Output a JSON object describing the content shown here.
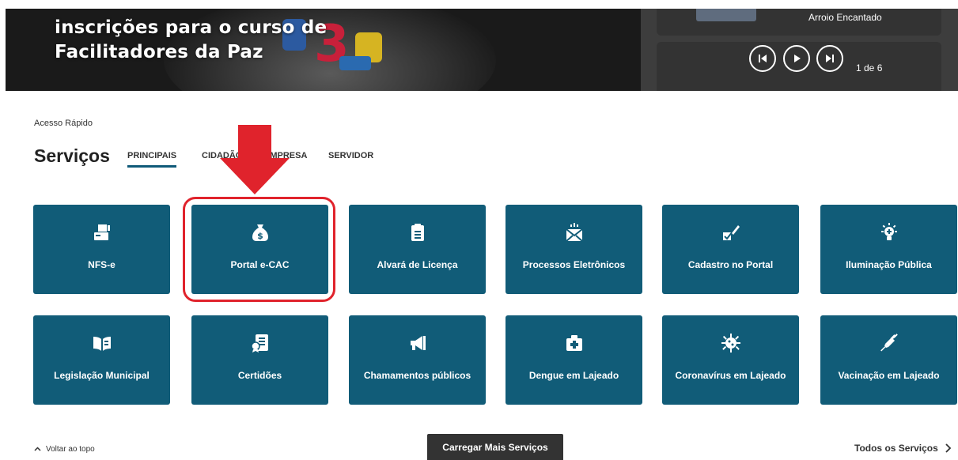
{
  "hero": {
    "title_line1": "inscrições para o curso de",
    "title_line2": "Facilitadores da Paz",
    "side_caption": "Arroio Encantado",
    "counter": "1 de 6"
  },
  "services": {
    "quick_access": "Acesso Rápido",
    "title": "Serviços",
    "tabs": [
      "PRINCIPAIS",
      "CIDADÃO",
      "EMPRESA",
      "SERVIDOR"
    ],
    "active_tab": "PRINCIPAIS",
    "tiles": [
      {
        "label": "NFS-e",
        "icon": "invoice-printer-icon"
      },
      {
        "label": "Portal e-CAC",
        "icon": "money-bag-icon"
      },
      {
        "label": "Alvará de Licença",
        "icon": "clipboard-icon"
      },
      {
        "label": "Processos Eletrônicos",
        "icon": "envelope-icon"
      },
      {
        "label": "Cadastro no Portal",
        "icon": "pen-checkbox-icon"
      },
      {
        "label": "Iluminação Pública",
        "icon": "lightbulb-icon"
      },
      {
        "label": "Legislação Municipal",
        "icon": "open-book-icon"
      },
      {
        "label": "Certidões",
        "icon": "certificate-icon"
      },
      {
        "label": "Chamamentos públicos",
        "icon": "megaphone-icon"
      },
      {
        "label": "Dengue em Lajeado",
        "icon": "first-aid-kit-icon"
      },
      {
        "label": "Coronavírus em Lajeado",
        "icon": "virus-icon"
      },
      {
        "label": "Vacinação em Lajeado",
        "icon": "syringe-icon"
      }
    ]
  },
  "footer": {
    "back_to_top": "Voltar ao topo",
    "load_more": "Carregar Mais Serviços",
    "all_services": "Todos os Serviços"
  },
  "colors": {
    "tile": "#115c78",
    "highlight": "#e0232c",
    "arrow": "#e0232c",
    "button": "#333333"
  }
}
